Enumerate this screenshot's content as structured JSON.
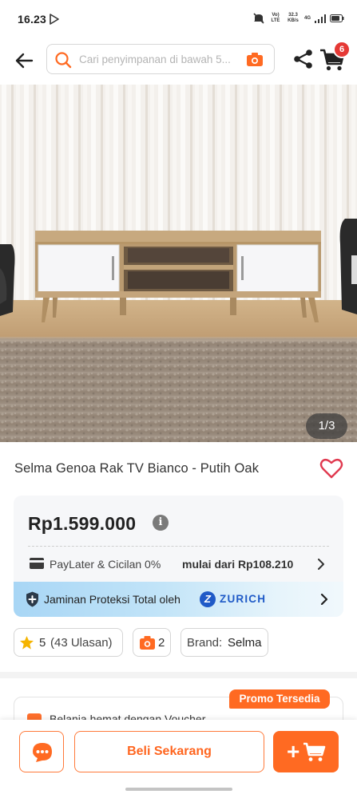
{
  "status_bar": {
    "time": "16.23",
    "network_line1": "Vo) LTE",
    "speed_value": "32.3",
    "speed_unit": "KB/s",
    "network_type": "4G"
  },
  "top_bar": {
    "search_placeholder": "Cari penyimpanan di bawah 5...",
    "cart_badge": "6"
  },
  "product": {
    "image_counter": "1/3",
    "title": "Selma Genoa Rak TV Bianco - Putih Oak"
  },
  "price_card": {
    "price": "Rp1.599.000",
    "info_icon_glyph": "i",
    "paylater_label": "PayLater & Cicilan 0%",
    "paylater_value": "mulai dari Rp108.210",
    "protection_label": "Jaminan Proteksi Total oleh",
    "protection_brand": "ZURICH",
    "protection_logo_glyph": "Z"
  },
  "chips": {
    "rating_value": "5",
    "rating_count": "(43 Ulasan)",
    "photo_count": "2",
    "brand_label": "Brand:",
    "brand_value": "Selma"
  },
  "voucher": {
    "text": "Belanja hemat dengan Voucher",
    "promo_badge": "Promo Tersedia"
  },
  "bottom_bar": {
    "buy_label": "Beli Sekarang",
    "add_cart_glyph": "+"
  },
  "colors": {
    "accent_orange": "#ff6a22",
    "badge_red": "#e53935",
    "zurich_blue": "#1f5ac7",
    "heart_red": "#e0394f",
    "star_yellow": "#f5b400"
  },
  "icons": [
    "back-arrow-icon",
    "search-icon",
    "camera-icon",
    "share-icon",
    "cart-icon",
    "heart-icon",
    "info-icon",
    "card-icon",
    "chevron-right-icon",
    "shield-icon",
    "star-icon",
    "photo-icon",
    "voucher-icon",
    "chat-icon",
    "add-to-cart-icon"
  ]
}
